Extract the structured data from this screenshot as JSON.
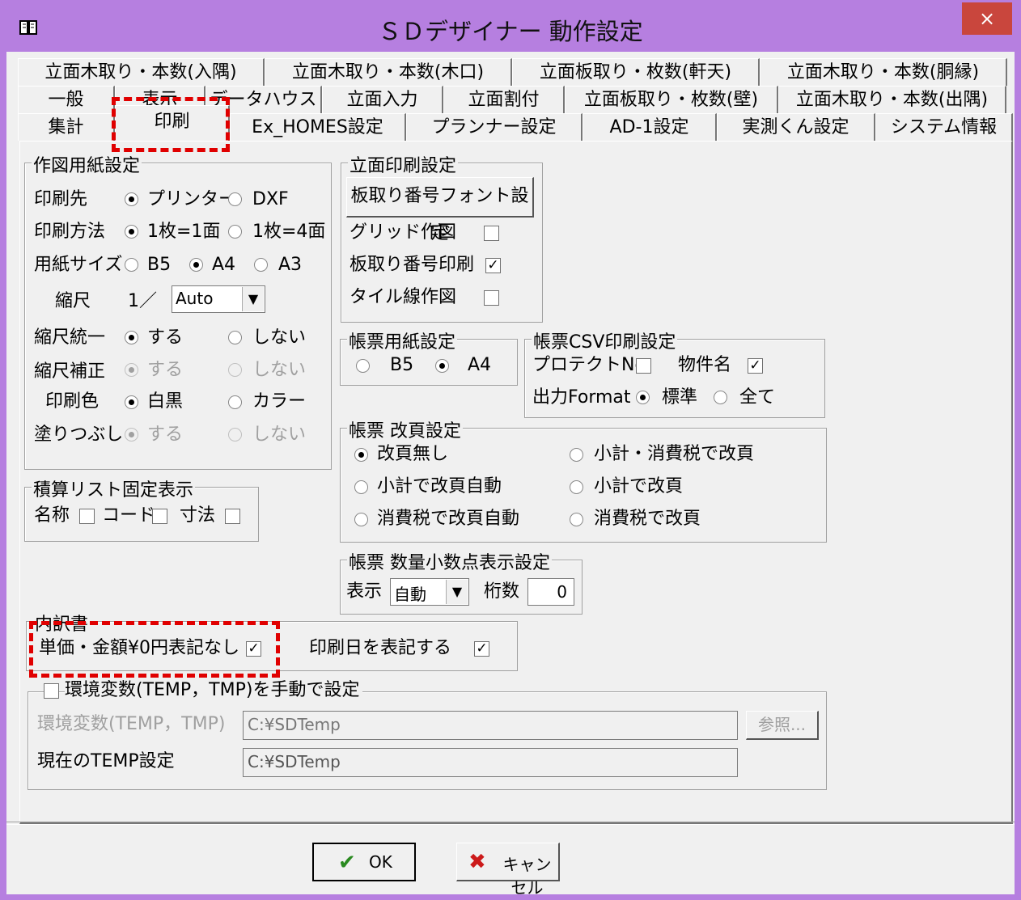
{
  "window": {
    "title": "ＳＤデザイナー 動作設定",
    "close": "×"
  },
  "tabs": {
    "row1": [
      "立面木取り・本数(入隅)",
      "立面木取り・本数(木口)",
      "立面板取り・枚数(軒天)",
      "立面木取り・本数(胴縁)"
    ],
    "row2": [
      "一般",
      "表示",
      "データハウス",
      "立面入力",
      "立面割付",
      "立面板取り・枚数(壁)",
      "立面木取り・本数(出隅)"
    ],
    "row3": [
      "集計",
      "印刷",
      "Ex_HOMES設定",
      "プランナー設定",
      "AD-1設定",
      "実測くん設定",
      "システム情報"
    ]
  },
  "sakuzu": {
    "title": "作図用紙設定",
    "print_to_label": "印刷先",
    "printer": "プリンター",
    "dxf": "DXF",
    "method_label": "印刷方法",
    "one": "1枚=1面",
    "four": "1枚=4面",
    "paper_label": "用紙サイズ",
    "b5": "B5",
    "a4": "A4",
    "a3": "A3",
    "scale_label": "縮尺",
    "scale_prefix": "1／",
    "scale_value": "Auto",
    "unify_label": "縮尺統一",
    "suru": "する",
    "shinai": "しない",
    "correct_label": "縮尺補正",
    "color_label": "印刷色",
    "mono": "白黒",
    "color": "カラー",
    "fill_label": "塗りつぶし"
  },
  "tally": {
    "title": "積算リスト固定表示",
    "name": "名称",
    "code": "コード",
    "size": "寸法"
  },
  "elev": {
    "title": "立面印刷設定",
    "font_button": "板取り番号フォント設定",
    "grid": "グリッド作図",
    "num_print": "板取り番号印刷",
    "tile": "タイル線作図",
    "num_print_checked": "✓"
  },
  "form_paper": {
    "title": "帳票用紙設定",
    "b5": "B5",
    "a4": "A4"
  },
  "csv": {
    "title": "帳票CSV印刷設定",
    "protect": "プロテクトNo.",
    "bukken": "物件名",
    "output_label": "出力Format",
    "standard": "標準",
    "all": "全て",
    "bukken_checked": "✓"
  },
  "page_break": {
    "title": "帳票 改頁設定",
    "none": "改頁無し",
    "sub_tax": "小計・消費税で改頁",
    "sub_auto": "小計で改頁自動",
    "sub": "小計で改頁",
    "tax_auto": "消費税で改頁自動",
    "tax": "消費税で改頁"
  },
  "decimal": {
    "title": "帳票 数量小数点表示設定",
    "display_label": "表示",
    "display_value": "自動",
    "digits_label": "桁数",
    "digits_value": "0"
  },
  "breakdown": {
    "title": "内訳書",
    "no_zero": "単価・金額¥0円表記なし",
    "print_date": "印刷日を表記する",
    "checked": "✓"
  },
  "env": {
    "title": "環境変数(TEMP，TMP)を手動で設定",
    "var_label": "環境変数(TEMP，TMP)",
    "var_value": "C:¥SDTemp",
    "browse": "参照...",
    "current_label": "現在のTEMP設定",
    "current_value": "C:¥SDTemp"
  },
  "buttons": {
    "ok": "OK",
    "cancel": "キャンセル",
    "ok_icon": "✔",
    "cancel_icon": "✖"
  },
  "colors": {
    "window_border": "#b67fe0",
    "close": "#c9463d",
    "highlight": "#e00000"
  }
}
